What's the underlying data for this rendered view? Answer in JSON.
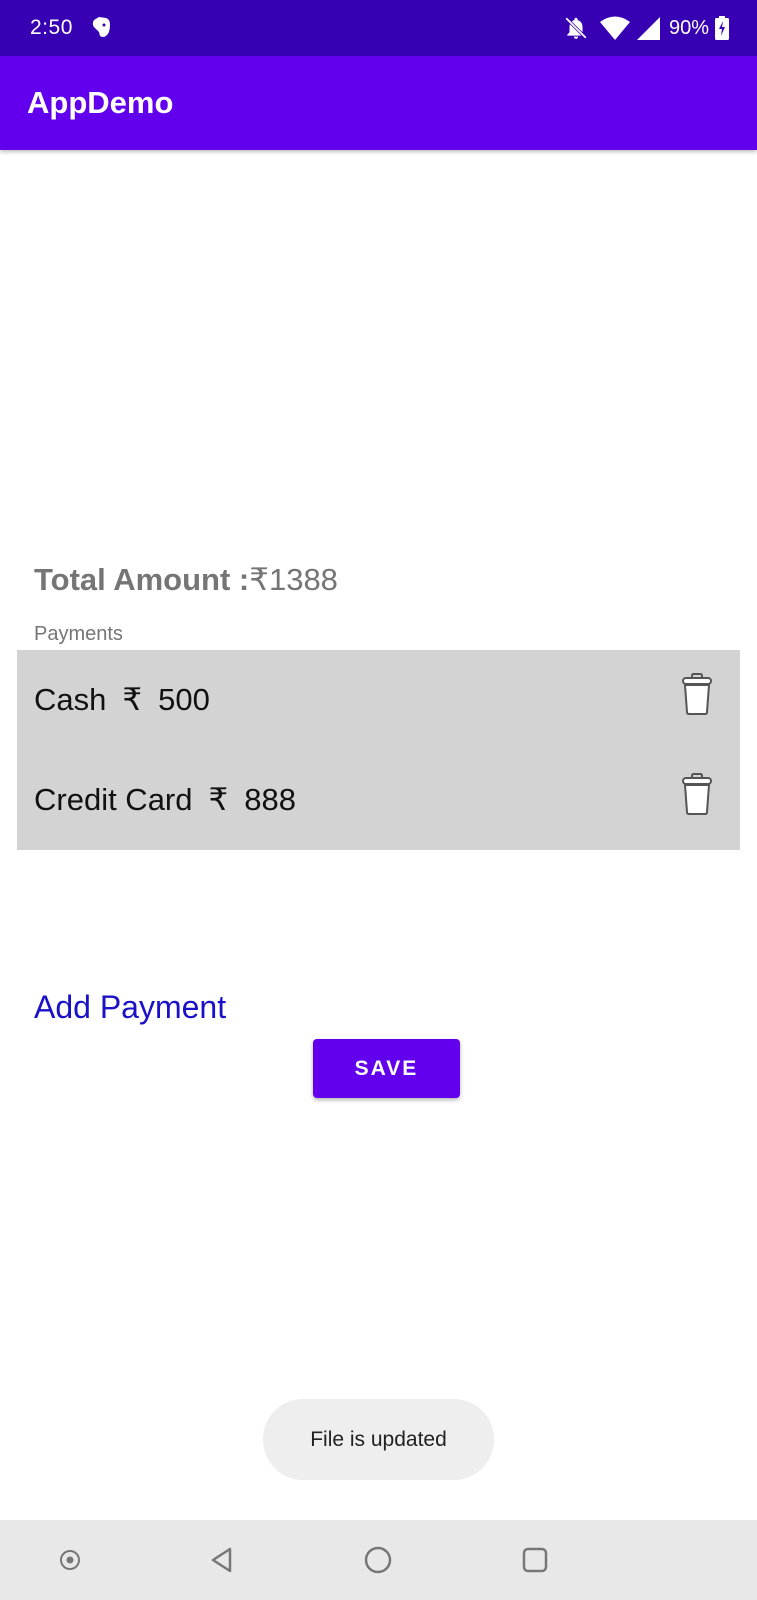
{
  "status_bar": {
    "time": "2:50",
    "battery": "90%",
    "icons": [
      "evernote-icon",
      "notifications-off-icon",
      "wifi-icon",
      "cellular-signal-icon",
      "battery-charging-icon"
    ]
  },
  "app_bar": {
    "title": "AppDemo"
  },
  "summary": {
    "total_label": "Total Amount :",
    "total_value": "₹1388"
  },
  "payments": {
    "section_label": "Payments",
    "items": [
      {
        "method": "Cash",
        "currency": "₹",
        "amount": "500"
      },
      {
        "method": "Credit Card",
        "currency": "₹",
        "amount": "888"
      }
    ]
  },
  "actions": {
    "add_payment": "Add Payment",
    "save": "SAVE"
  },
  "toast": {
    "message": "File is updated"
  },
  "nav_bar": {
    "icons": [
      "accessibility-icon",
      "back-icon",
      "home-icon",
      "recents-icon"
    ]
  },
  "colors": {
    "status_bar": "#3700b3",
    "app_bar": "#6200ee",
    "primary": "#6200ee",
    "link": "#1a10c8",
    "list_background": "#d3d3d3"
  }
}
